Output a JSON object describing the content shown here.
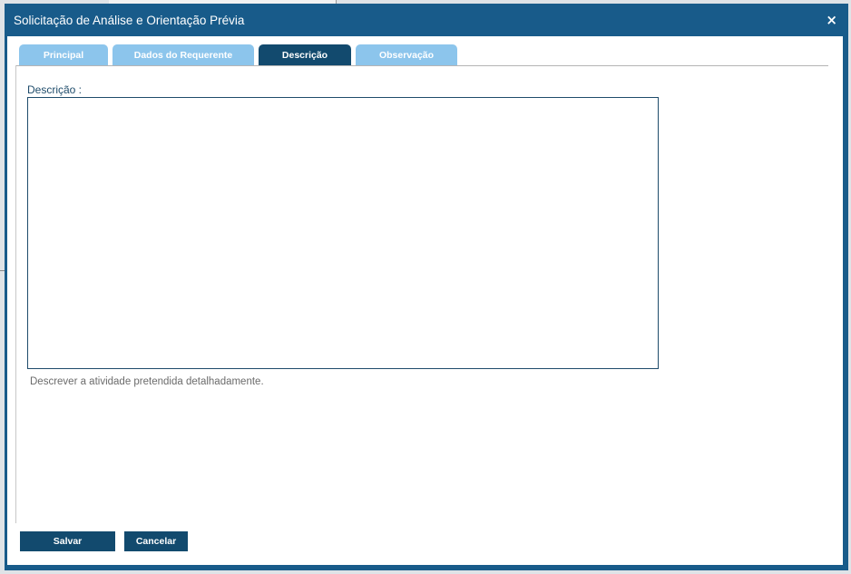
{
  "modal": {
    "title": "Solicitação de Análise e Orientação Prévia",
    "close_symbol": "×"
  },
  "tabs": [
    {
      "label": "Principal",
      "active": false
    },
    {
      "label": "Dados do Requerente",
      "active": false
    },
    {
      "label": "Descrição",
      "active": true
    },
    {
      "label": "Observação",
      "active": false
    }
  ],
  "form": {
    "description_label": "Descrição :",
    "description_value": "",
    "help_text": "Descrever a atividade pretendida detalhadamente."
  },
  "footer": {
    "save_label": "Salvar",
    "cancel_label": "Cancelar"
  },
  "colors": {
    "header_bg": "#185b8a",
    "tab_active": "#124a6e",
    "tab_inactive": "#8cc5ec",
    "button_bg": "#124a6e"
  },
  "icons": {
    "close": "close-icon"
  }
}
